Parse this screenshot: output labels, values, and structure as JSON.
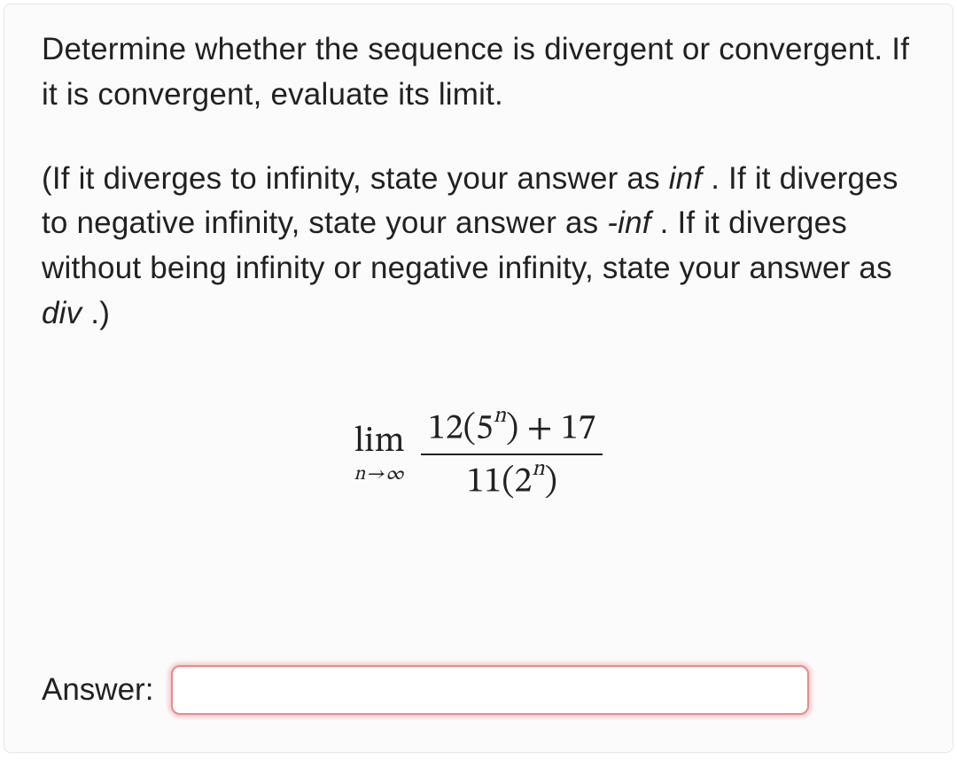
{
  "question": {
    "para1": "Determine whether the sequence is divergent or convergent. If it is convergent, evaluate its limit.",
    "para2_pre": "(If it diverges to infinity, state your answer as ",
    "kw_inf": "inf",
    "para2_mid1": " . If it diverges to negative infinity, state your answer as ",
    "kw_neg_inf": "-inf",
    "para2_mid2": " . If it diverges without being infinity or negative infinity, state your answer as ",
    "kw_div": "div",
    "para2_end": " .)"
  },
  "formula": {
    "lim": "lim",
    "sub_n": "n",
    "sub_arrow": "→",
    "sub_inf": "∞",
    "num_a": "12(5",
    "num_exp": "n",
    "num_b": ") + 17",
    "den_a": "11(2",
    "den_exp": "n",
    "den_b": ")"
  },
  "answer": {
    "label": "Answer:",
    "value": ""
  }
}
